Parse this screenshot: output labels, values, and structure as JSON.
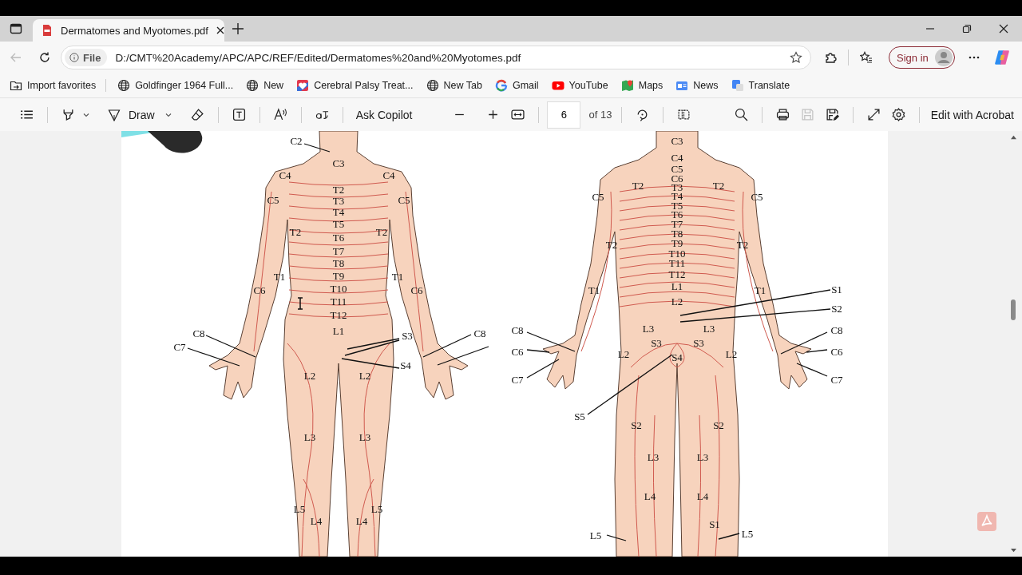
{
  "tabs": [
    {
      "title": "Dermatomes and Myotomes.pdf",
      "selected": true
    }
  ],
  "address_bar": {
    "scheme": "File",
    "url": "D:/CMT%20Academy/APC/APC/REF/Edited/Dermatomes%20and%20Myotomes.pdf",
    "sign_in": "Sign in"
  },
  "favorites": [
    {
      "label": "Import favorites",
      "kind": "import"
    },
    {
      "label": "Goldfinger 1964 Full...",
      "kind": "globe"
    },
    {
      "label": "New",
      "kind": "globe"
    },
    {
      "label": "Cerebral Palsy Treat...",
      "kind": "tile"
    },
    {
      "label": "New Tab",
      "kind": "globe"
    },
    {
      "label": "Gmail",
      "kind": "google"
    },
    {
      "label": "YouTube",
      "kind": "youtube"
    },
    {
      "label": "Maps",
      "kind": "maps"
    },
    {
      "label": "News",
      "kind": "news"
    },
    {
      "label": "Translate",
      "kind": "translate"
    }
  ],
  "pdf_toolbar": {
    "draw": "Draw",
    "ask_copilot": "Ask Copilot",
    "page": "6",
    "page_count": "of 13",
    "save_disabled": true,
    "edit": "Edit with Acrobat"
  },
  "document": {
    "front_labels": [
      "C2",
      "C3",
      "C4",
      "C4",
      "T2",
      "C5",
      "T3",
      "C5",
      "T4",
      "T5",
      "T2",
      "T2",
      "T6",
      "T7",
      "T8",
      "T1",
      "T9",
      "T1",
      "C6",
      "T10",
      "C6",
      "T11",
      "T12",
      "C8",
      "L1",
      "S3",
      "C8",
      "C7",
      "S4",
      "L2",
      "L2",
      "L3",
      "L3",
      "L5",
      "L5",
      "L4",
      "L4"
    ],
    "back_labels": [
      "C3",
      "C4",
      "C5",
      "C6",
      "T2",
      "T3",
      "T2",
      "C5",
      "T4",
      "C5",
      "T5",
      "T6",
      "T7",
      "T8",
      "T2",
      "T9",
      "T2",
      "T10",
      "T11",
      "T12",
      "T1",
      "L1",
      "T1",
      "S1",
      "L2",
      "S2",
      "C8",
      "L3",
      "L3",
      "C8",
      "S3",
      "S3",
      "C6",
      "L2",
      "S4",
      "L2",
      "C6",
      "C7",
      "C7",
      "S5",
      "S2",
      "S2",
      "L3",
      "L3",
      "L4",
      "L4",
      "S1",
      "L5",
      "L5"
    ]
  }
}
